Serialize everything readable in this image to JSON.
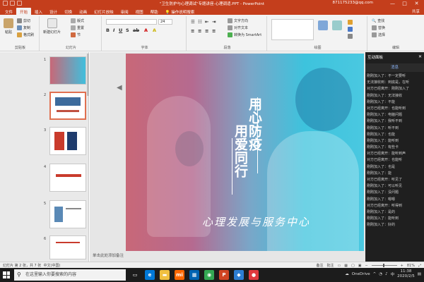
{
  "window": {
    "title": "\"卫生防护与心理调试\"专题讲座-心理调适.PPT - PowerPoint",
    "account": "871175233@qq.com",
    "min": "—",
    "max": "□",
    "close": "✕"
  },
  "ribbon_tabs": [
    "文件",
    "开始",
    "插入",
    "设计",
    "切换",
    "动画",
    "幻灯片放映",
    "审阅",
    "视图",
    "帮助"
  ],
  "active_tab": "开始",
  "tell_me": "操作说明搜索",
  "share": "共享",
  "ribbon": {
    "paste": "粘贴",
    "cut": "剪切",
    "copy": "复制",
    "format_painter": "格式刷",
    "new_slide": "新建幻灯片",
    "layout": "版式",
    "reset": "重置",
    "section": "节",
    "font_size": "24",
    "text_direction": "文字方向",
    "align_text": "对齐文本",
    "convert_smartart": "转换为 SmartArt",
    "find": "查找",
    "replace": "替换",
    "select": "选择",
    "groups": {
      "clipboard": "剪贴板",
      "slides": "幻灯片",
      "font": "字体",
      "paragraph": "段落",
      "drawing": "绘图",
      "editing": "编辑"
    }
  },
  "thumbnails": [
    {
      "num": "1",
      "color": "#3a8fc0"
    },
    {
      "num": "2",
      "color": "#ffffff"
    },
    {
      "num": "3",
      "color": "#ffffff"
    },
    {
      "num": "4",
      "color": "#ffffff"
    },
    {
      "num": "5",
      "color": "#ffffff"
    },
    {
      "num": "6",
      "color": "#ffffff"
    }
  ],
  "slide": {
    "title_col1": "用心防疫",
    "title_col2": "用爱同行",
    "subtitle": "心理发展与服务中心"
  },
  "notes_placeholder": "单击此处添加备注",
  "panel": {
    "title": "互动面板",
    "tab": "消息",
    "messages": [
      "刚刚加入了：不一定要听",
      "无法接收到：到底是，在听",
      "对方已经离开：刚刚加入了",
      "刚刚加入了：无法接收",
      "刚刚加入了：不能",
      "对方已经离开：也能听到",
      "刚刚加入了：电脑问题",
      "刚刚加入了：我听不到",
      "刚刚加入了：听不到",
      "刚刚加入了：也能",
      "刚刚加入了：能听到",
      "刚刚加入了：有些卡",
      "对方已经离开：能听到声",
      "对方已经离开：也能听",
      "刚刚加入了：也是",
      "刚刚加入了：能",
      "对方已经离开：听见了",
      "刚刚加入了：可以听见",
      "刚刚加入了：没问题",
      "刚刚加入了：嗯嗯",
      "对方已经离开：听得到",
      "刚刚加入了：是的",
      "刚刚加入了：能听到",
      "刚刚加入了：好的"
    ]
  },
  "status": {
    "slide_info": "幻灯片 第 2 张，共 7 张",
    "language": "中文(中国)",
    "notes": "备注",
    "comments": "批注",
    "zoom": "81%"
  },
  "taskbar": {
    "search_placeholder": "在这里输入你要搜索的内容",
    "onedrive": "OneDrive",
    "ime": "中",
    "time": "11:38",
    "date": "2020/2/5",
    "apps": [
      {
        "name": "task-view-icon",
        "glyph": "▭",
        "color": "#1c1c1c"
      },
      {
        "name": "edge-icon",
        "glyph": "e",
        "color": "#0078d7"
      },
      {
        "name": "explorer-icon",
        "glyph": "▬",
        "color": "#f0c040"
      },
      {
        "name": "mi-icon",
        "glyph": "mi",
        "color": "#ff6700"
      },
      {
        "name": "store-icon",
        "glyph": "▦",
        "color": "#0063b1"
      },
      {
        "name": "chrome-icon",
        "glyph": "◉",
        "color": "#34a853"
      },
      {
        "name": "powerpoint-icon",
        "glyph": "P",
        "color": "#d04423"
      },
      {
        "name": "app-icon",
        "glyph": "◆",
        "color": "#2d7dd2"
      },
      {
        "name": "app2-icon",
        "glyph": "●",
        "color": "#e0393e"
      }
    ]
  }
}
